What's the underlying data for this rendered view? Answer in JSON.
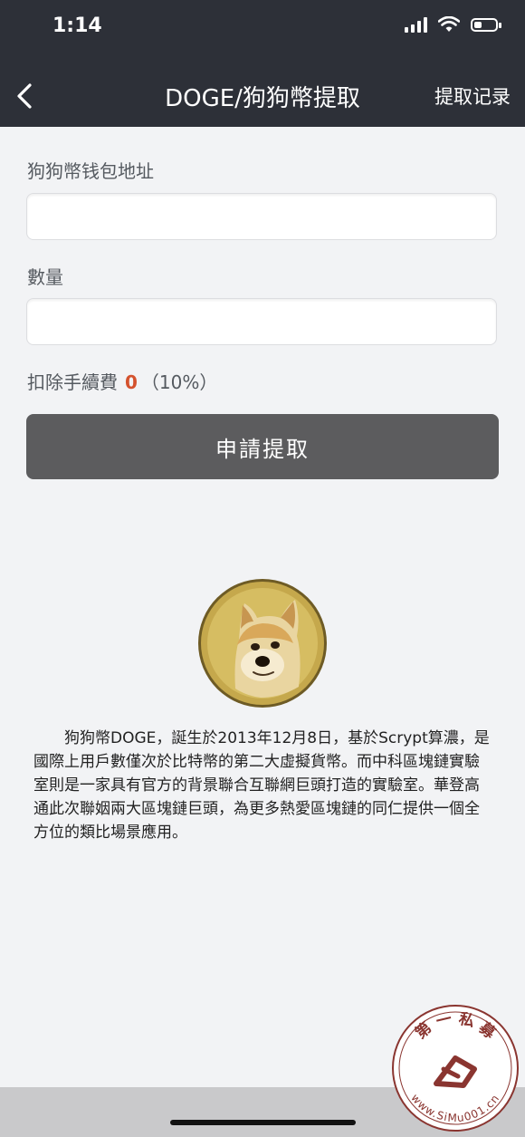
{
  "status_bar": {
    "time": "1:14"
  },
  "header": {
    "title": "DOGE/狗狗幣提取",
    "history_link": "提取记录"
  },
  "form": {
    "address_label": "狗狗幣钱包地址",
    "address_value": "",
    "amount_label": "數量",
    "amount_value": "",
    "fee_label": "扣除手續費",
    "fee_value": "0",
    "fee_rate": "（10%）",
    "submit_label": "申請提取"
  },
  "description": "狗狗幣DOGE，誕生於2013年12月8日，基於Scrypt算濃，是國際上用戶數僅次於比特幣的第二大虛擬貨幣。而中科區塊鏈實驗室則是一家具有官方的背景聯合互聯網巨頭打造的實驗室。華登高通此次聯姻兩大區塊鏈巨頭，為更多熱愛區塊鏈的同仁提供一個全方位的類比場景應用。",
  "watermark": {
    "top_text": "第 一 私 募",
    "bottom_text": "www.SiMu001.cn"
  },
  "colors": {
    "header_bg": "#2d3038",
    "page_bg": "#f2f3f5",
    "fee_value": "#d4522e",
    "button_bg": "#5c5c5e"
  }
}
